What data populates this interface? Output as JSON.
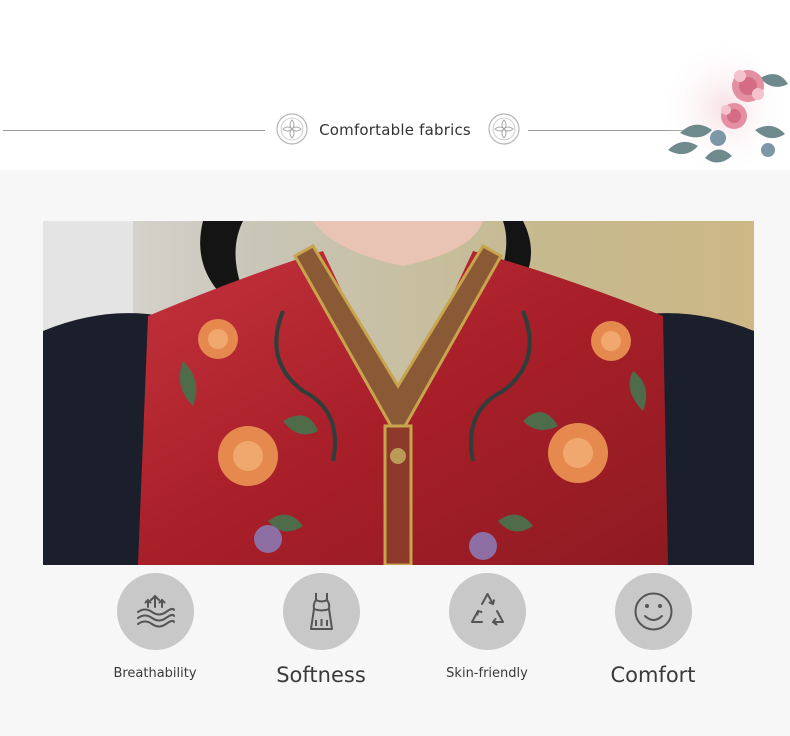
{
  "header": {
    "title": "Comfortable fabrics"
  },
  "features": [
    {
      "label": "Breathability",
      "icon": "breathability-waves-icon"
    },
    {
      "label": "Softness",
      "icon": "garment-dress-icon"
    },
    {
      "label": "Skin-friendly",
      "icon": "recycle-triangle-icon"
    },
    {
      "label": "Comfort",
      "icon": "smiley-face-icon"
    }
  ],
  "colors": {
    "icon_circle": "#c8c8c8",
    "icon_stroke": "#555555",
    "vest_red": "#b0212a",
    "sleeve_black": "#1b1f2b"
  }
}
